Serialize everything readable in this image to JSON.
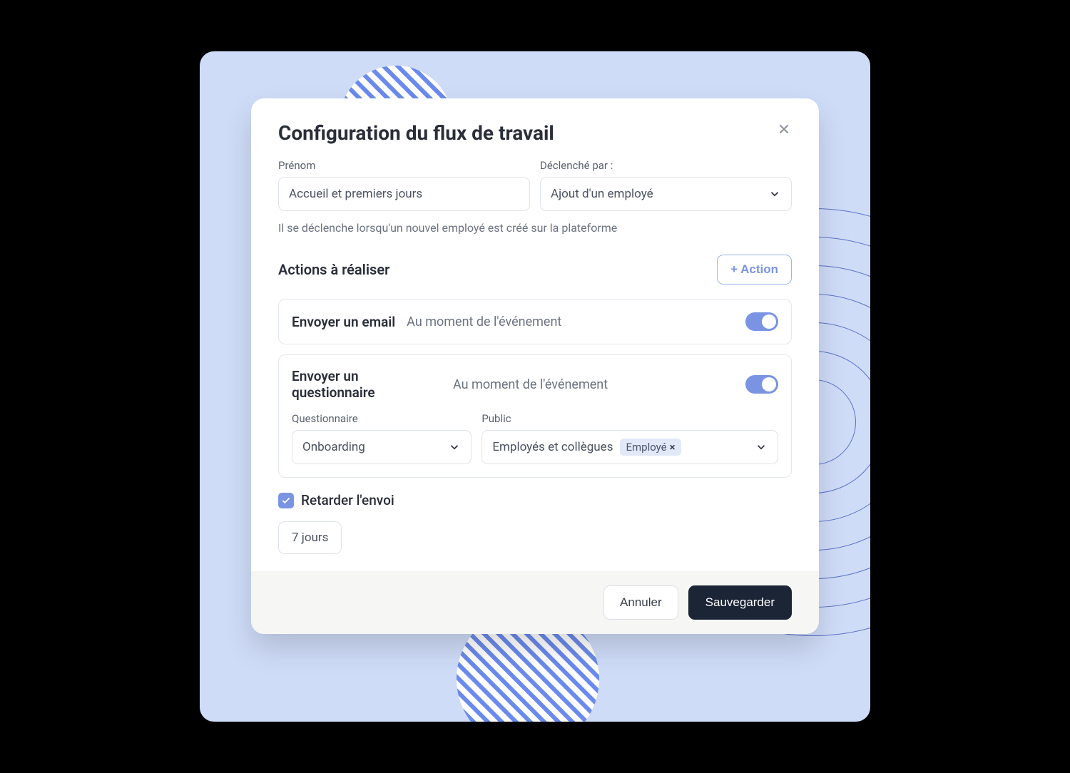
{
  "modal": {
    "title": "Configuration du flux de travail",
    "name_label": "Prénom",
    "name_value": "Accueil et premiers jours",
    "trigger_label": "Déclenché par :",
    "trigger_value": "Ajout d'un employé",
    "help_text": "Il se déclenche lorsqu'un nouvel employé est créé sur la plateforme",
    "actions_title": "Actions à réaliser",
    "add_action_label": "+ Action"
  },
  "actions": [
    {
      "title": "Envoyer un email",
      "timing": "Au moment de l'événement",
      "enabled": true
    },
    {
      "title": "Envoyer un questionnaire",
      "timing": "Au moment de l'événement",
      "enabled": true,
      "questionnaire_label": "Questionnaire",
      "questionnaire_value": "Onboarding",
      "audience_label": "Public",
      "audience_value": "Employés et collègues",
      "audience_tag": "Employé"
    }
  ],
  "delay": {
    "checkbox_label": "Retarder l'envoi",
    "checked": true,
    "value": "7 jours"
  },
  "footer": {
    "cancel": "Annuler",
    "save": "Sauvegarder"
  },
  "colors": {
    "accent": "#7a94e3",
    "backdrop": "#cfdcf8",
    "dark": "#1c2536"
  }
}
